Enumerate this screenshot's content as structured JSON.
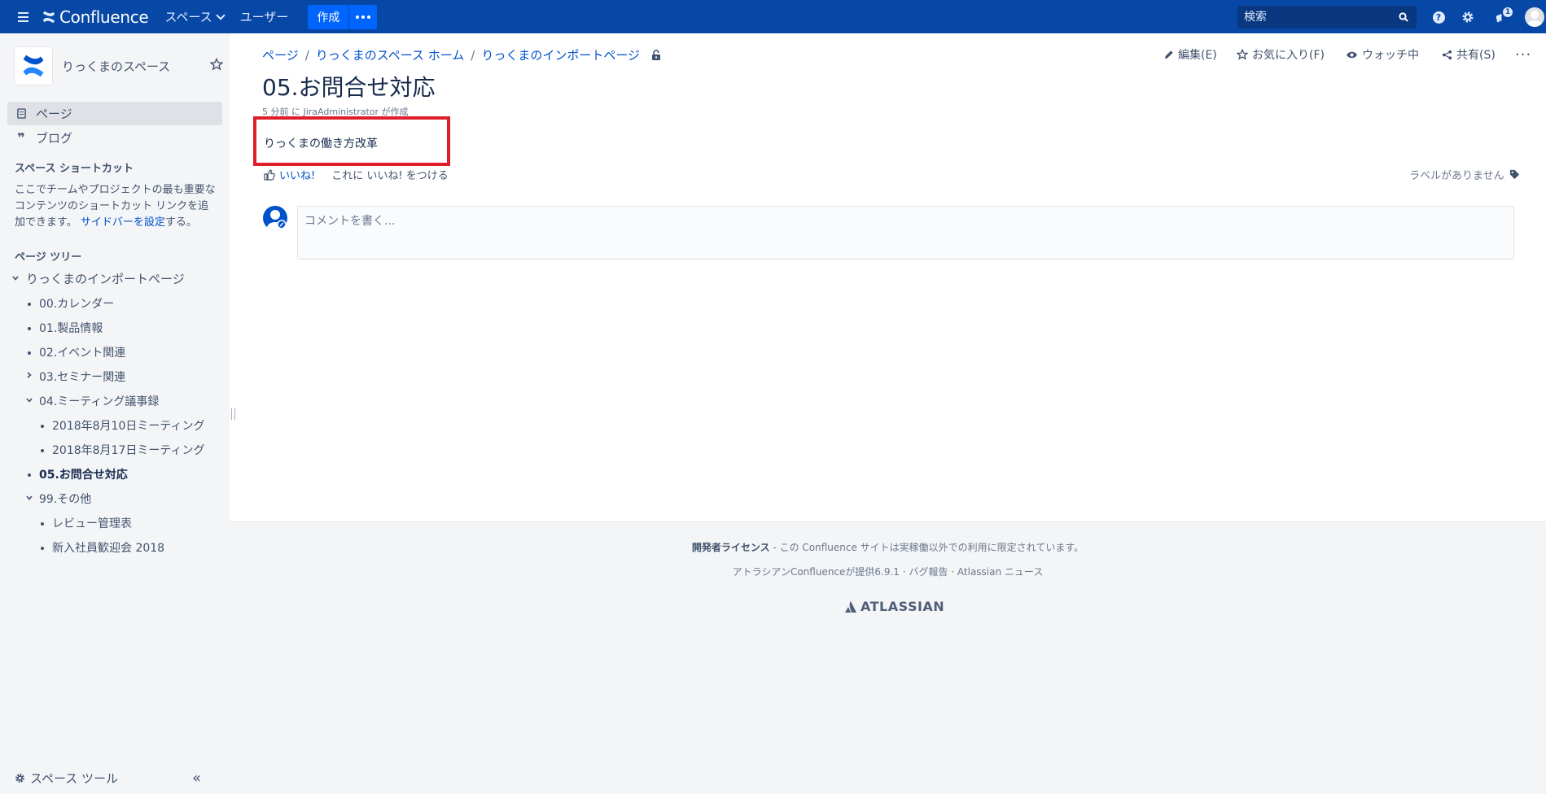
{
  "header": {
    "app_name": "Confluence",
    "nav_spaces": "スペース",
    "nav_users": "ユーザー",
    "create": "作成",
    "search_placeholder": "検索",
    "notification_count": "1"
  },
  "sidebar": {
    "space_name": "りっくまのスペース",
    "links": {
      "pages": "ページ",
      "blog": "ブログ"
    },
    "shortcuts_heading": "スペース ショートカット",
    "shortcuts_text": "ここでチームやプロジェクトの最も重要なコンテンツのショートカット リンクを追加できます。",
    "shortcuts_link": "サイドバーを設定",
    "shortcuts_suffix": "する。",
    "tree_heading": "ページ ツリー",
    "tree": [
      "りっくまのインポートページ",
      "00.カレンダー",
      "01.製品情報",
      "02.イベント関連",
      "03.セミナー関連",
      "04.ミーティング議事録",
      "2018年8月10日ミーティング",
      "2018年8月17日ミーティング",
      "05.お問合せ対応",
      "99.その他",
      "レビュー管理表",
      "新入社員歓迎会 2018"
    ],
    "space_tools": "スペース ツール"
  },
  "breadcrumb": [
    "ページ",
    "りっくまのスペース ホーム",
    "りっくまのインポートページ"
  ],
  "actions": {
    "edit": "編集(E)",
    "favorite": "お気に入り(F)",
    "watch": "ウォッチ中",
    "share": "共有(S)"
  },
  "page": {
    "title": "05.お問合せ対応",
    "byline": "5 分前 に JiraAdministrator が作成",
    "body": "りっくまの働き方改革",
    "like": "いいね!",
    "like_msg": "これに いいね! をつける",
    "labels": "ラベルがありません",
    "comment_placeholder": "コメントを書く..."
  },
  "footer": {
    "license_bold": "開発者ライセンス",
    "license_text": " - この Confluence サイトは実稼働以外での利用に限定されています。",
    "powered": "アトラシアンConfluenceが提供6.9.1",
    "bug": "バグ報告",
    "news": "Atlassian ニュース",
    "logo": "ATLASSIAN"
  },
  "colors": {
    "header_bg": "#0747a6",
    "sidebar_bg": "#f4f5f7",
    "link": "#0052cc",
    "highlight": "#e01e2b"
  }
}
